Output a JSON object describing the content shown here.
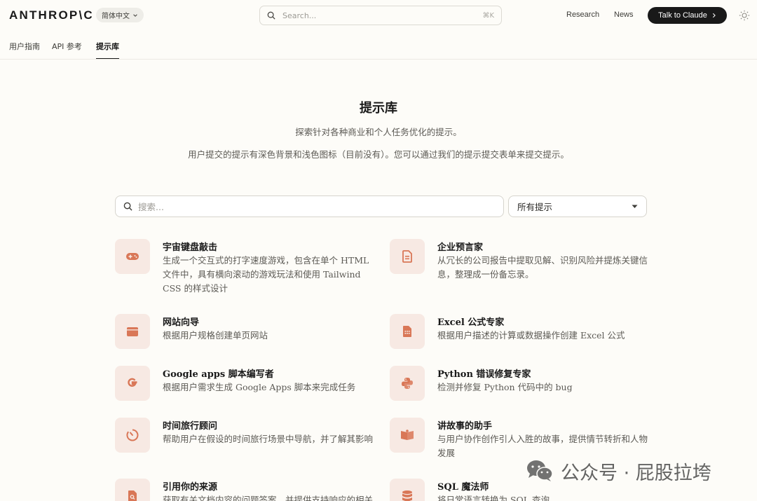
{
  "header": {
    "logo": "ANTHROP\\C",
    "language": "简体中文",
    "search_placeholder": "Search...",
    "search_shortcut": "⌘K",
    "nav": [
      "Research",
      "News"
    ],
    "cta": "Talk to Claude",
    "theme_icon": "sun-icon"
  },
  "subnav": {
    "tabs": [
      {
        "label": "用户指南",
        "active": false
      },
      {
        "label": "API 参考",
        "active": false
      },
      {
        "label": "提示库",
        "active": true
      }
    ]
  },
  "hero": {
    "title": "提示库",
    "line1": "探索针对各种商业和个人任务优化的提示。",
    "line2": "用户提交的提示有深色背景和浅色图标（目前没有）。您可以通过我们的提示提交表单来提交提示。"
  },
  "filters": {
    "search_placeholder": "搜索...",
    "select_value": "所有提示"
  },
  "cards": [
    {
      "title": "宇宙键盘敲击",
      "desc": "生成一个交互式的打字速度游戏，包含在单个 HTML 文件中，具有横向滚动的游戏玩法和使用 Tailwind CSS 的样式设计",
      "icon": "gamepad-icon"
    },
    {
      "title": "企业预言家",
      "desc": "从冗长的公司报告中提取见解、识别风险并提炼关键信息，整理成一份备忘录。",
      "icon": "document-icon"
    },
    {
      "title": "网站向导",
      "desc": "根据用户规格创建单页网站",
      "icon": "browser-window-icon"
    },
    {
      "title": "Excel 公式专家",
      "desc": "根据用户描述的计算或数据操作创建 Excel 公式",
      "icon": "spreadsheet-icon"
    },
    {
      "title": "Google apps 脚本编写者",
      "desc": "根据用户需求生成 Google Apps 脚本来完成任务",
      "icon": "google-icon"
    },
    {
      "title": "Python 错误修复专家",
      "desc": "检测并修复 Python 代码中的 bug",
      "icon": "python-icon"
    },
    {
      "title": "时间旅行顾问",
      "desc": "帮助用户在假设的时间旅行场景中导航，并了解其影响",
      "icon": "timer-icon"
    },
    {
      "title": "讲故事的助手",
      "desc": "与用户协作创作引人入胜的故事，提供情节转折和人物发展",
      "icon": "open-book-icon"
    },
    {
      "title": "引用你的来源",
      "desc": "获取有关文档内容的问题答案，并提供支持响应的相关",
      "icon": "document-search-icon"
    },
    {
      "title": "SQL 魔法师",
      "desc": "将日常语言转换为 SQL 查询",
      "icon": "database-icon"
    }
  ],
  "watermark": {
    "text": "公众号 · 屁股拉垮",
    "icon": "wechat-icon"
  },
  "colors": {
    "accent": "#d97757",
    "icon_bg": "#f7e9e3",
    "page_bg": "#fdfcf8",
    "cta_bg": "#191919"
  }
}
